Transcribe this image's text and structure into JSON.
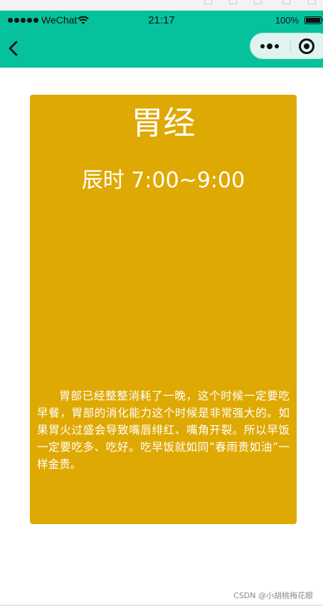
{
  "status_bar": {
    "carrier": "WeChat",
    "time": "21:17",
    "battery": "100%"
  },
  "nav": {
    "back_icon": "chevron-left-icon",
    "menu_icon": "more-dots-icon",
    "close_icon": "target-circle-icon"
  },
  "card": {
    "title": "胃经",
    "time_range": "辰时 7:00~9:00",
    "description": "胃部已经整整消耗了一晚，这个时候一定要吃早餐，胃部的消化能力这个时候是非常强大的。如果胃火过盛会导致嘴唇绯红、嘴角开裂。所以早饭一定要吃多、吃好。吃早饭就如同“春雨贵如油”一样金贵。"
  },
  "watermark": "CSDN @小胡桃梅花眼",
  "colors": {
    "header": "#05c29c",
    "card": "#dfa903"
  }
}
